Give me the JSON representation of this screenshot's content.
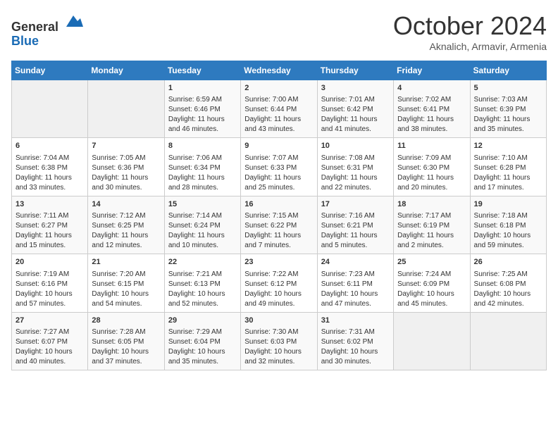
{
  "header": {
    "logo_line1": "General",
    "logo_line2": "Blue",
    "month": "October 2024",
    "location": "Aknalich, Armavir, Armenia"
  },
  "days_of_week": [
    "Sunday",
    "Monday",
    "Tuesday",
    "Wednesday",
    "Thursday",
    "Friday",
    "Saturday"
  ],
  "weeks": [
    [
      {
        "day": "",
        "sunrise": "",
        "sunset": "",
        "daylight": ""
      },
      {
        "day": "",
        "sunrise": "",
        "sunset": "",
        "daylight": ""
      },
      {
        "day": "1",
        "sunrise": "Sunrise: 6:59 AM",
        "sunset": "Sunset: 6:46 PM",
        "daylight": "Daylight: 11 hours and 46 minutes."
      },
      {
        "day": "2",
        "sunrise": "Sunrise: 7:00 AM",
        "sunset": "Sunset: 6:44 PM",
        "daylight": "Daylight: 11 hours and 43 minutes."
      },
      {
        "day": "3",
        "sunrise": "Sunrise: 7:01 AM",
        "sunset": "Sunset: 6:42 PM",
        "daylight": "Daylight: 11 hours and 41 minutes."
      },
      {
        "day": "4",
        "sunrise": "Sunrise: 7:02 AM",
        "sunset": "Sunset: 6:41 PM",
        "daylight": "Daylight: 11 hours and 38 minutes."
      },
      {
        "day": "5",
        "sunrise": "Sunrise: 7:03 AM",
        "sunset": "Sunset: 6:39 PM",
        "daylight": "Daylight: 11 hours and 35 minutes."
      }
    ],
    [
      {
        "day": "6",
        "sunrise": "Sunrise: 7:04 AM",
        "sunset": "Sunset: 6:38 PM",
        "daylight": "Daylight: 11 hours and 33 minutes."
      },
      {
        "day": "7",
        "sunrise": "Sunrise: 7:05 AM",
        "sunset": "Sunset: 6:36 PM",
        "daylight": "Daylight: 11 hours and 30 minutes."
      },
      {
        "day": "8",
        "sunrise": "Sunrise: 7:06 AM",
        "sunset": "Sunset: 6:34 PM",
        "daylight": "Daylight: 11 hours and 28 minutes."
      },
      {
        "day": "9",
        "sunrise": "Sunrise: 7:07 AM",
        "sunset": "Sunset: 6:33 PM",
        "daylight": "Daylight: 11 hours and 25 minutes."
      },
      {
        "day": "10",
        "sunrise": "Sunrise: 7:08 AM",
        "sunset": "Sunset: 6:31 PM",
        "daylight": "Daylight: 11 hours and 22 minutes."
      },
      {
        "day": "11",
        "sunrise": "Sunrise: 7:09 AM",
        "sunset": "Sunset: 6:30 PM",
        "daylight": "Daylight: 11 hours and 20 minutes."
      },
      {
        "day": "12",
        "sunrise": "Sunrise: 7:10 AM",
        "sunset": "Sunset: 6:28 PM",
        "daylight": "Daylight: 11 hours and 17 minutes."
      }
    ],
    [
      {
        "day": "13",
        "sunrise": "Sunrise: 7:11 AM",
        "sunset": "Sunset: 6:27 PM",
        "daylight": "Daylight: 11 hours and 15 minutes."
      },
      {
        "day": "14",
        "sunrise": "Sunrise: 7:12 AM",
        "sunset": "Sunset: 6:25 PM",
        "daylight": "Daylight: 11 hours and 12 minutes."
      },
      {
        "day": "15",
        "sunrise": "Sunrise: 7:14 AM",
        "sunset": "Sunset: 6:24 PM",
        "daylight": "Daylight: 11 hours and 10 minutes."
      },
      {
        "day": "16",
        "sunrise": "Sunrise: 7:15 AM",
        "sunset": "Sunset: 6:22 PM",
        "daylight": "Daylight: 11 hours and 7 minutes."
      },
      {
        "day": "17",
        "sunrise": "Sunrise: 7:16 AM",
        "sunset": "Sunset: 6:21 PM",
        "daylight": "Daylight: 11 hours and 5 minutes."
      },
      {
        "day": "18",
        "sunrise": "Sunrise: 7:17 AM",
        "sunset": "Sunset: 6:19 PM",
        "daylight": "Daylight: 11 hours and 2 minutes."
      },
      {
        "day": "19",
        "sunrise": "Sunrise: 7:18 AM",
        "sunset": "Sunset: 6:18 PM",
        "daylight": "Daylight: 10 hours and 59 minutes."
      }
    ],
    [
      {
        "day": "20",
        "sunrise": "Sunrise: 7:19 AM",
        "sunset": "Sunset: 6:16 PM",
        "daylight": "Daylight: 10 hours and 57 minutes."
      },
      {
        "day": "21",
        "sunrise": "Sunrise: 7:20 AM",
        "sunset": "Sunset: 6:15 PM",
        "daylight": "Daylight: 10 hours and 54 minutes."
      },
      {
        "day": "22",
        "sunrise": "Sunrise: 7:21 AM",
        "sunset": "Sunset: 6:13 PM",
        "daylight": "Daylight: 10 hours and 52 minutes."
      },
      {
        "day": "23",
        "sunrise": "Sunrise: 7:22 AM",
        "sunset": "Sunset: 6:12 PM",
        "daylight": "Daylight: 10 hours and 49 minutes."
      },
      {
        "day": "24",
        "sunrise": "Sunrise: 7:23 AM",
        "sunset": "Sunset: 6:11 PM",
        "daylight": "Daylight: 10 hours and 47 minutes."
      },
      {
        "day": "25",
        "sunrise": "Sunrise: 7:24 AM",
        "sunset": "Sunset: 6:09 PM",
        "daylight": "Daylight: 10 hours and 45 minutes."
      },
      {
        "day": "26",
        "sunrise": "Sunrise: 7:25 AM",
        "sunset": "Sunset: 6:08 PM",
        "daylight": "Daylight: 10 hours and 42 minutes."
      }
    ],
    [
      {
        "day": "27",
        "sunrise": "Sunrise: 7:27 AM",
        "sunset": "Sunset: 6:07 PM",
        "daylight": "Daylight: 10 hours and 40 minutes."
      },
      {
        "day": "28",
        "sunrise": "Sunrise: 7:28 AM",
        "sunset": "Sunset: 6:05 PM",
        "daylight": "Daylight: 10 hours and 37 minutes."
      },
      {
        "day": "29",
        "sunrise": "Sunrise: 7:29 AM",
        "sunset": "Sunset: 6:04 PM",
        "daylight": "Daylight: 10 hours and 35 minutes."
      },
      {
        "day": "30",
        "sunrise": "Sunrise: 7:30 AM",
        "sunset": "Sunset: 6:03 PM",
        "daylight": "Daylight: 10 hours and 32 minutes."
      },
      {
        "day": "31",
        "sunrise": "Sunrise: 7:31 AM",
        "sunset": "Sunset: 6:02 PM",
        "daylight": "Daylight: 10 hours and 30 minutes."
      },
      {
        "day": "",
        "sunrise": "",
        "sunset": "",
        "daylight": ""
      },
      {
        "day": "",
        "sunrise": "",
        "sunset": "",
        "daylight": ""
      }
    ]
  ]
}
